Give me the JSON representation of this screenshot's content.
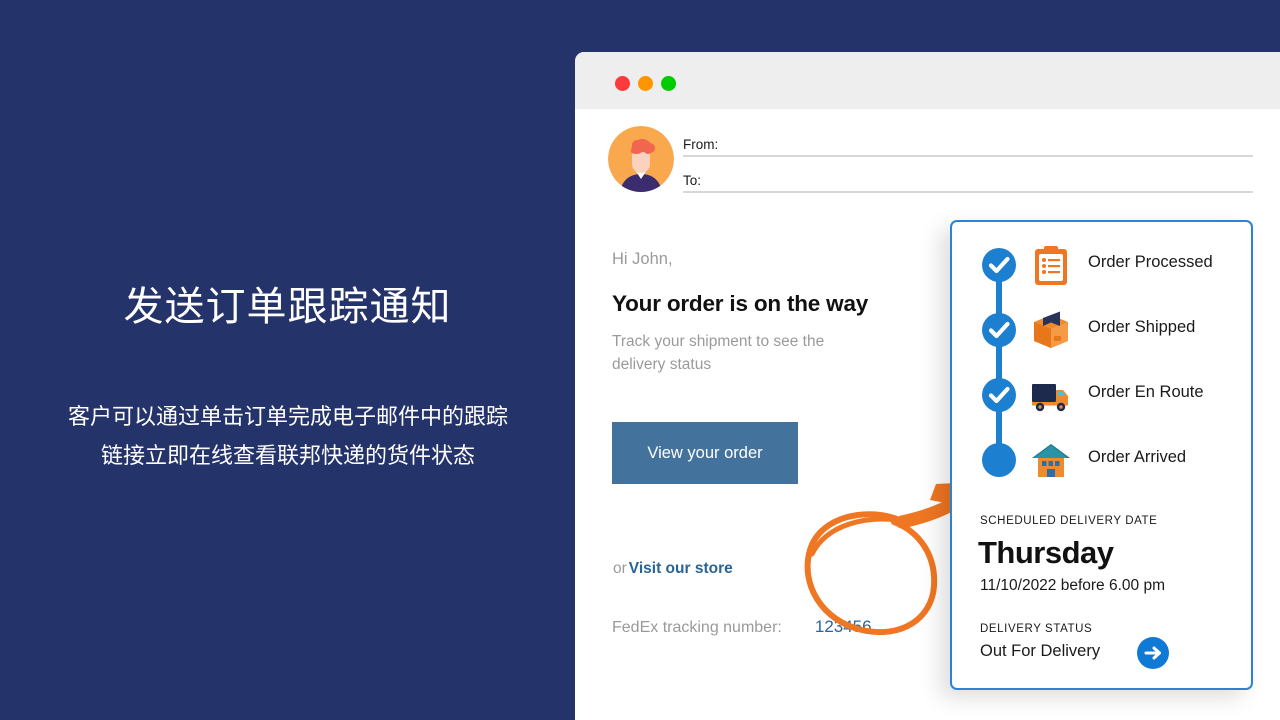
{
  "promo": {
    "title": "发送订单跟踪通知",
    "subtitle_lines": [
      "客户可以通过单击订单完成电子邮件中的跟踪",
      "链接立即在线查看联邦快递的货件状态"
    ],
    "background_color": "#25336b"
  },
  "window": {
    "dots": [
      {
        "name": "close",
        "color": "#fb3b3b"
      },
      {
        "name": "minimize",
        "color": "#ff9500"
      },
      {
        "name": "maximize",
        "color": "#00cc00"
      }
    ]
  },
  "email_header": {
    "avatar_icon": "user-avatar-icon",
    "from_label": "From:",
    "to_label": "To:"
  },
  "email_body": {
    "greeting": "Hi John,",
    "headline": "Your order is on the way",
    "subline": "Track your shipment to see the delivery status",
    "primary_button": "View your order",
    "or_text": "or",
    "store_link": "Visit our store",
    "tracking_label": "FedEx tracking number:",
    "tracking_number": "123456",
    "button_color": "#43739c",
    "link_color": "#2a6496"
  },
  "annotation": {
    "shape": "hand-drawn-circle-with-arrow",
    "color": "#ef7622",
    "target": "123456"
  },
  "tracking_card": {
    "border_color": "#2b83d6",
    "accent_color": "#1d7fd0",
    "steps": [
      {
        "label": "Order Processed",
        "icon": "clipboard-icon",
        "state": "complete"
      },
      {
        "label": "Order Shipped",
        "icon": "package-box-icon",
        "state": "complete"
      },
      {
        "label": "Order En Route",
        "icon": "delivery-truck-icon",
        "state": "complete"
      },
      {
        "label": "Order Arrived",
        "icon": "house-icon",
        "state": "pending"
      }
    ],
    "scheduled_label": "SCHEDULED DELIVERY DATE",
    "scheduled_day": "Thursday",
    "scheduled_detail": "11/10/2022 before 6.00 pm",
    "status_label": "DELIVERY STATUS",
    "status_value": "Out For Delivery",
    "status_arrow_icon": "arrow-right-circle-icon"
  }
}
